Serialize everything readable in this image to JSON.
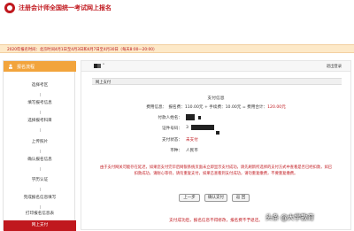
{
  "header": {
    "title": "注册会计师全国统一考试网上报名"
  },
  "notice": {
    "text": "2020年报名时间：北京时间4月1日至4月3日和4月7日至4月30日（每天8:00—20:00）"
  },
  "sidebar": {
    "heading": "报名流程",
    "items": [
      "选择考区",
      "填写报考信息",
      "选择报考科目",
      "上传照片",
      "确认报名信息",
      "学历认证",
      "完成报名信息填写",
      "打印报名信息表"
    ],
    "active": "网上支付"
  },
  "main": {
    "user": "“",
    "logout": "退出登录",
    "section": "网上支付",
    "pay_title": "支付信息",
    "fee": {
      "prefix": "费用信息：　报名费：110.00元 + 手续费：10.00元 = 费用合计：",
      "total": "120.00元"
    },
    "rows": {
      "payer_label": "付款人姓名：",
      "id_label": "证件号码：",
      "id_value": "3",
      "status_label": "支付状态：",
      "status_value": "未支付",
      "currency_label": "币种：",
      "currency_value": "人民币"
    },
    "warning": "由于支付网关可能存在延迟，如果您支付完毕后网银系统页面未立即显示支付成功，请先刷新所选择的支付方式中查看是否已经扣款，如已扣款成功，请耐心等待，请勿重复支付，如果已查看到支付成功，请勿重复缴费，不要重复缴费。",
    "buttons": {
      "prev": "上一步",
      "confirm": "确认支付",
      "back": "返 回"
    },
    "bottom_warning": "支付成功后，报名信息不得修改，报名费不予退还。"
  },
  "watermark": "头条 @大学教育",
  "colors": {
    "brand": "#c0181e",
    "notice_bg": "#fde9c8",
    "sidebar_head": "#f2a43c"
  }
}
